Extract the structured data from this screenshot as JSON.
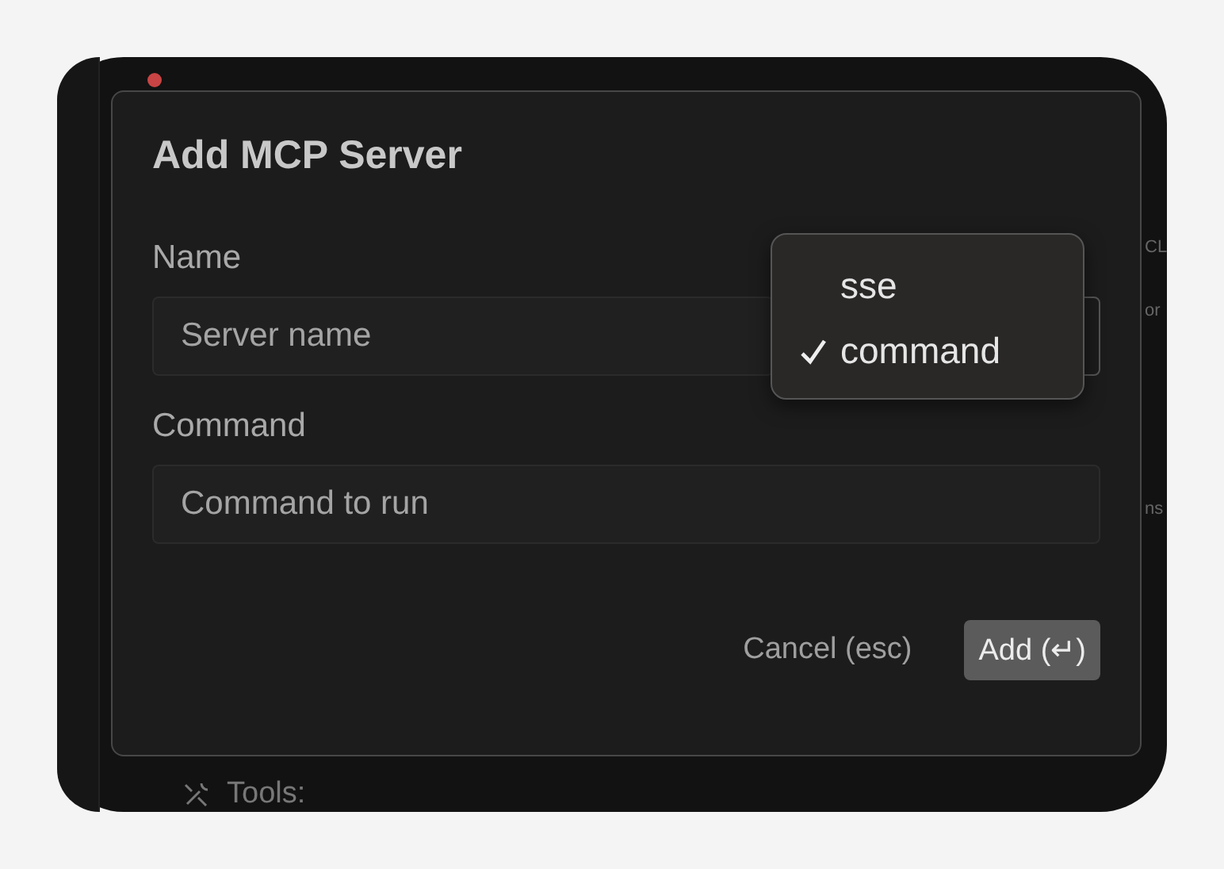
{
  "backdrop": {
    "fragments": [
      "CL",
      "or",
      "ns"
    ],
    "tools_label": "Tools:"
  },
  "dialog": {
    "title": "Add MCP Server",
    "fields": [
      {
        "label": "Name",
        "placeholder": "Server name"
      },
      {
        "label": "Command",
        "placeholder": "Command to run"
      }
    ],
    "type_menu": {
      "options": [
        {
          "label": "sse",
          "selected": false
        },
        {
          "label": "command",
          "selected": true
        }
      ]
    },
    "buttons": [
      {
        "label": "Cancel (esc)",
        "kind": "secondary"
      },
      {
        "label": "Add (↵)",
        "kind": "primary"
      }
    ]
  }
}
